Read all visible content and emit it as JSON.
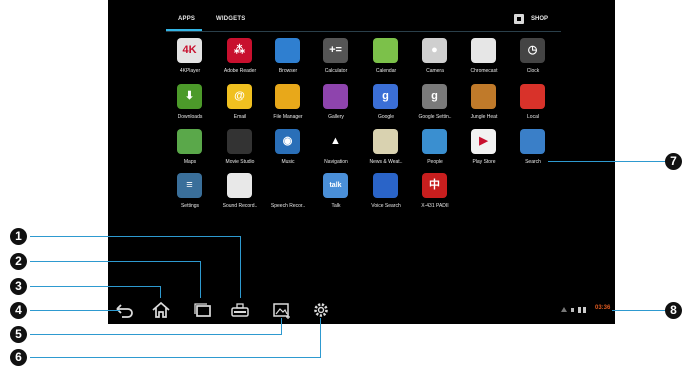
{
  "tabs": {
    "apps": "APPS",
    "widgets": "WIDGETS",
    "shop": "SHOP"
  },
  "apps": [
    {
      "label": "4KPlayer",
      "color": "#e4e4e4",
      "icon": "4kplayer-icon",
      "glyph": "4K"
    },
    {
      "label": "Adobe Reader",
      "color": "#c8102e",
      "icon": "adobe-reader-icon",
      "glyph": "⁂"
    },
    {
      "label": "Browser",
      "color": "#2f7fd0",
      "icon": "browser-globe-icon",
      "glyph": ""
    },
    {
      "label": "Calculator",
      "color": "#555555",
      "icon": "calculator-icon",
      "glyph": "+="
    },
    {
      "label": "Calendar",
      "color": "#7cc14a",
      "icon": "calendar-icon",
      "glyph": ""
    },
    {
      "label": "Camera",
      "color": "#cfcfcf",
      "icon": "camera-icon",
      "glyph": "●"
    },
    {
      "label": "Chromecast",
      "color": "#e6e6e6",
      "icon": "chromecast-icon",
      "glyph": ""
    },
    {
      "label": "Clock",
      "color": "#444444",
      "icon": "clock-icon",
      "glyph": "◷"
    },
    {
      "label": "Downloads",
      "color": "#4c9a2a",
      "icon": "downloads-icon",
      "glyph": "⬇"
    },
    {
      "label": "Email",
      "color": "#f0c020",
      "icon": "email-icon",
      "glyph": "@"
    },
    {
      "label": "File Manager",
      "color": "#e8a81a",
      "icon": "folder-icon",
      "glyph": ""
    },
    {
      "label": "Gallery",
      "color": "#8e44ad",
      "icon": "gallery-icon",
      "glyph": ""
    },
    {
      "label": "Google",
      "color": "#3b6fd6",
      "icon": "google-search-icon",
      "glyph": "g"
    },
    {
      "label": "Google Settin..",
      "color": "#7a7a7a",
      "icon": "google-settings-icon",
      "glyph": "g"
    },
    {
      "label": "Jungle Heat",
      "color": "#c07a2a",
      "icon": "jungle-heat-icon",
      "glyph": ""
    },
    {
      "label": "Local",
      "color": "#d8322a",
      "icon": "map-pin-icon",
      "glyph": ""
    },
    {
      "label": "Maps",
      "color": "#5aa84a",
      "icon": "maps-icon",
      "glyph": ""
    },
    {
      "label": "Movie Studio",
      "color": "#333333",
      "icon": "clapperboard-icon",
      "glyph": ""
    },
    {
      "label": "Music",
      "color": "#2a6fb8",
      "icon": "music-icon",
      "glyph": "◉"
    },
    {
      "label": "Navigation",
      "color": "#000000",
      "icon": "navigation-arrow-icon",
      "glyph": "▲"
    },
    {
      "label": "News & Weat..",
      "color": "#d9d2b0",
      "icon": "news-weather-icon",
      "glyph": ""
    },
    {
      "label": "People",
      "color": "#3a8fd0",
      "icon": "people-icon",
      "glyph": ""
    },
    {
      "label": "Play Store",
      "color": "#f2f2f2",
      "icon": "play-store-icon",
      "glyph": "▶"
    },
    {
      "label": "Search",
      "color": "#3a7fc8",
      "icon": "search-magnifier-icon",
      "glyph": ""
    },
    {
      "label": "Settings",
      "color": "#3a6f9a",
      "icon": "settings-sliders-icon",
      "glyph": "≡"
    },
    {
      "label": "Sound Record..",
      "color": "#e8e8e8",
      "icon": "sound-recorder-icon",
      "glyph": ""
    },
    {
      "label": "Speech Recor..",
      "color": "#000000",
      "icon": "android-robot-icon",
      "glyph": ""
    },
    {
      "label": "Talk",
      "color": "#4a8fd8",
      "icon": "talk-icon",
      "glyph": "talk"
    },
    {
      "label": "Voice Search",
      "color": "#2a64c8",
      "icon": "microphone-icon",
      "glyph": ""
    },
    {
      "label": "X-431 PADII",
      "color": "#c81e1e",
      "icon": "x431-icon",
      "glyph": "中"
    }
  ],
  "status": {
    "time": "03:36"
  },
  "callouts": [
    "1",
    "2",
    "3",
    "4",
    "5",
    "6",
    "7",
    "8"
  ]
}
